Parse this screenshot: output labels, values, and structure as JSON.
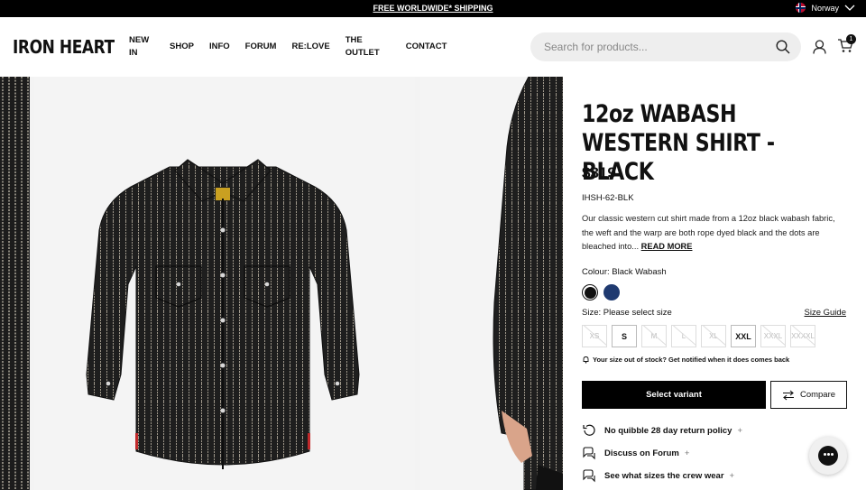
{
  "topbar": {
    "shipping": "FREE WORLDWIDE* SHIPPING",
    "country": "Norway"
  },
  "header": {
    "logo": "IRON HEART",
    "nav": [
      "NEW IN",
      "SHOP",
      "INFO",
      "FORUM",
      "RE:LOVE",
      "THE OUTLET",
      "CONTACT"
    ],
    "search_placeholder": "Search for products...",
    "cart_count": "1"
  },
  "product": {
    "title": "12oz Wabash Western Shirt - Black",
    "price": "$319",
    "sku": "IHSH-62-BLK",
    "description": "Our classic western cut shirt made from a 12oz black wabash fabric, the weft and the warp are both rope dyed black and the dots are bleached into...",
    "read_more": "READ MORE",
    "colour_label": "Colour:",
    "colour_value": "Black Wabash",
    "size_label": "Size:",
    "size_value": "Please select size",
    "size_guide": "Size Guide",
    "sizes": [
      {
        "label": "XS",
        "available": false
      },
      {
        "label": "S",
        "available": true
      },
      {
        "label": "M",
        "available": false
      },
      {
        "label": "L",
        "available": false
      },
      {
        "label": "XL",
        "available": false
      },
      {
        "label": "XXL",
        "available": true
      },
      {
        "label": "XXXL",
        "available": false
      },
      {
        "label": "XXXXL",
        "available": false
      }
    ],
    "notify": "Your size out of stock? Get notified when it does comes back",
    "select_variant": "Select variant",
    "compare": "Compare",
    "features": [
      "No quibble 28 day return policy",
      "Discuss on Forum",
      "See what sizes the crew wear"
    ]
  },
  "colors": {
    "accent": "#000000",
    "swatch_navy": "#1f3a70"
  }
}
